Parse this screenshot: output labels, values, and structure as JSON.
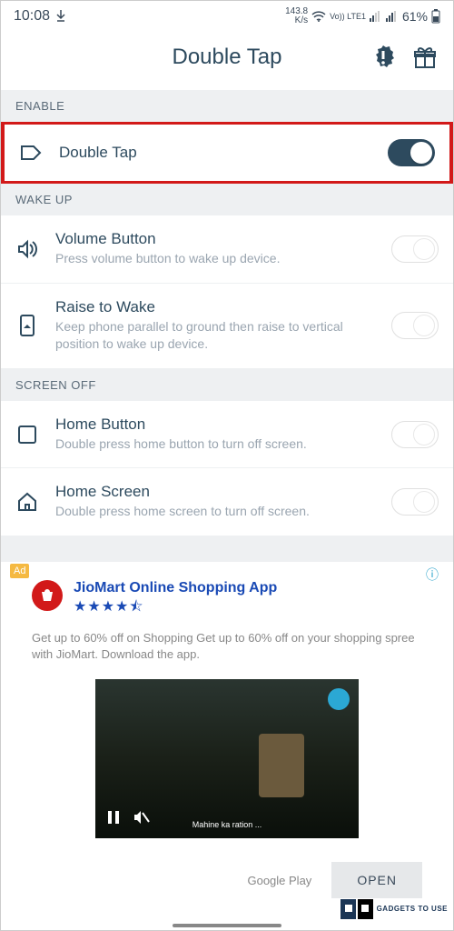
{
  "status": {
    "time": "10:08",
    "speed_value": "143.8",
    "speed_unit": "K/s",
    "network": "Vo)) LTE1",
    "battery": "61%"
  },
  "header": {
    "title": "Double Tap"
  },
  "sections": {
    "enable": {
      "label": "ENABLE",
      "items": {
        "double_tap": {
          "title": "Double Tap"
        }
      }
    },
    "wake_up": {
      "label": "WAKE UP",
      "items": {
        "volume": {
          "title": "Volume Button",
          "desc": "Press volume button to wake up device."
        },
        "raise": {
          "title": "Raise to Wake",
          "desc": "Keep phone parallel to ground then raise to vertical position to wake up device."
        }
      }
    },
    "screen_off": {
      "label": "SCREEN OFF",
      "items": {
        "home_btn": {
          "title": "Home Button",
          "desc": "Double press home button to turn off screen."
        },
        "home_scr": {
          "title": "Home Screen",
          "desc": "Double press home screen to turn off screen."
        }
      }
    }
  },
  "ad": {
    "badge": "Ad",
    "title": "JioMart Online Shopping App",
    "stars": "★★★★⯪",
    "desc": "Get up to 60% off on Shopping Get up to 60% off on your shopping spree with JioMart. Download the app.",
    "caption": "Mahine ka ration ...",
    "source": "Google Play",
    "open": "OPEN"
  },
  "watermark": "GADGETS TO USE"
}
